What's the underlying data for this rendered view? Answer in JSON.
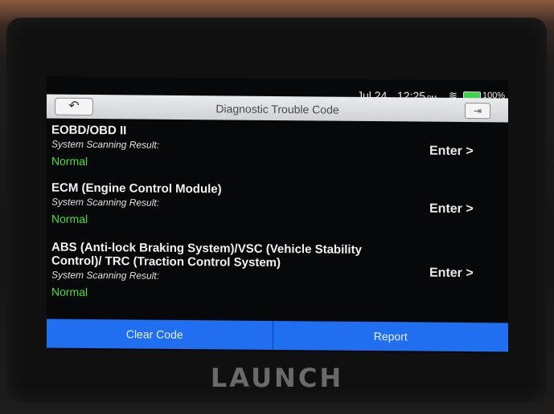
{
  "device": {
    "brand": "LAUNCH"
  },
  "status_bar": {
    "date": "Jul 24",
    "time": "12:25",
    "time_suffix": "PM",
    "battery": "100%",
    "wifi_icon": "wifi-icon",
    "battery_icon": "battery-icon"
  },
  "header": {
    "title": "Diagnostic Trouble Code",
    "back_icon": "back-arrow-icon",
    "exit_icon": "exit-icon"
  },
  "systems": [
    {
      "name": "EOBD/OBD II",
      "sub": "System Scanning Result:",
      "status": "Normal",
      "enter": "Enter >"
    },
    {
      "name": "ECM (Engine Control Module)",
      "sub": "System Scanning Result:",
      "status": "Normal",
      "enter": "Enter >"
    },
    {
      "name": "ABS (Anti-lock Braking System)/VSC (Vehicle Stability Control)/ TRC (Traction Control System)",
      "sub": "System Scanning Result:",
      "status": "Normal",
      "enter": "Enter >"
    }
  ],
  "footer": {
    "clear_label": "Clear Code",
    "report_label": "Report"
  },
  "colors": {
    "accent": "#1f6ff0",
    "status_ok": "#4ddc3a"
  }
}
